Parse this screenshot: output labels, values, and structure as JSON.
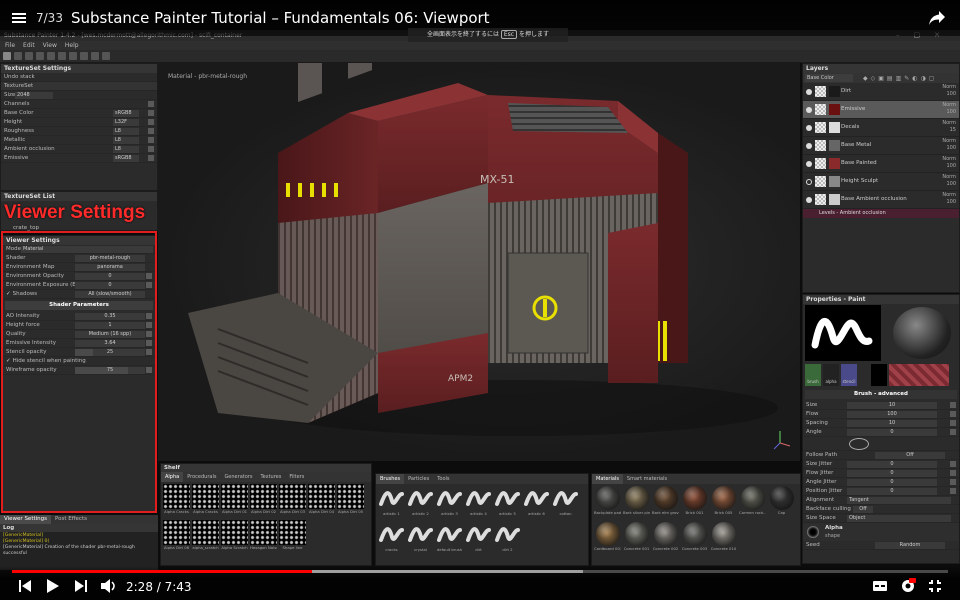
{
  "youtube": {
    "counter": "7/33",
    "title": "Substance Painter Tutorial – Fundamentals 06: Viewport",
    "time": "2:28 / 7:43",
    "progress_fraction": 0.32,
    "buffered_fraction": 0.61,
    "fullscreen_msg": "全画面表示を終了するには",
    "fullscreen_key": "Esc",
    "fullscreen_msg_tail": "を押します",
    "accent": "#ff0000"
  },
  "app": {
    "window_title": "Substance Painter 1.4.2 - [wes.mcdermott@allegorithmic.com] - scifi_container",
    "menu": [
      "File",
      "Edit",
      "View",
      "Help"
    ]
  },
  "textureset_settings": {
    "title": "TextureSet Settings",
    "undo": "Undo stack",
    "textureset_label": "TextureSet",
    "size_label": "Size",
    "size_value": "2048",
    "channels_label": "Channels",
    "channels": [
      {
        "name": "Base Color",
        "fmt": "sRGB8"
      },
      {
        "name": "Height",
        "fmt": "L32F"
      },
      {
        "name": "Roughness",
        "fmt": "L8"
      },
      {
        "name": "Metallic",
        "fmt": "L8"
      },
      {
        "name": "Ambient occlusion",
        "fmt": "L8"
      },
      {
        "name": "Emissive",
        "fmt": "sRGB8"
      }
    ]
  },
  "textureset_list": {
    "title": "TextureSet List",
    "item": "crate_top"
  },
  "callout": "Viewer Settings",
  "viewer_settings": {
    "title": "Viewer Settings",
    "mode_label": "Mode",
    "mode_value": "Material",
    "rows": [
      {
        "label": "Shader",
        "value": "pbr-metal-rough"
      },
      {
        "label": "Environment Map",
        "value": "panorama"
      },
      {
        "label": "Environment Opacity",
        "value": "0"
      },
      {
        "label": "Environment Exposure (EV)",
        "value": "0"
      },
      {
        "label": "Shadows",
        "value": "All (slow/smooth)"
      }
    ],
    "shader_params_title": "Shader Parameters",
    "shader_params": [
      {
        "label": "AO Intensity",
        "value": "0.35"
      },
      {
        "label": "Height force",
        "value": "1"
      },
      {
        "label": "Quality",
        "value": "Medium (16 spp)"
      },
      {
        "label": "Emissive Intensity",
        "value": "3.64"
      }
    ],
    "stencil_label": "Stencil opacity",
    "stencil_value": "25",
    "hide_stencil": "Hide stencil when painting",
    "wire_label": "Wireframe opacity",
    "wire_value": "75"
  },
  "left_tabs": [
    "Viewer Settings",
    "Post Effects"
  ],
  "log": {
    "title": "Log",
    "lines": [
      "[GenericMaterial]",
      "[GenericMaterial] 0(",
      "[GenericMaterial] Creation of the shader pbr-metal-rough",
      "successful"
    ]
  },
  "viewport": {
    "label": "Material - pbr-metal-rough",
    "decal_1": "MX-51",
    "decal_2": "APM2"
  },
  "layers": {
    "title": "Layers",
    "channel": "Base Color",
    "items": [
      {
        "name": "Dirt",
        "blend": "Norm",
        "opacity": "100"
      },
      {
        "name": "Emissive",
        "blend": "Norm",
        "opacity": "100"
      },
      {
        "name": "Decals",
        "blend": "Norm",
        "opacity": "15"
      },
      {
        "name": "Base Metal",
        "blend": "Norm",
        "opacity": "100"
      },
      {
        "name": "Base Painted",
        "blend": "Norm",
        "opacity": "100"
      },
      {
        "name": "Height Sculpt",
        "blend": "Norm",
        "opacity": "100"
      },
      {
        "name": "Base Ambient occlusion",
        "blend": "Norm",
        "opacity": "100"
      }
    ],
    "levels": "Levels - Ambient occlusion"
  },
  "properties": {
    "title": "Properties - Paint",
    "slots": [
      "brush",
      "alpha",
      "stencil"
    ],
    "brush_advanced": "Brush - advanced",
    "rows": [
      {
        "label": "Size",
        "value": "10"
      },
      {
        "label": "Flow",
        "value": "100"
      },
      {
        "label": "Spacing",
        "value": "10"
      },
      {
        "label": "Angle",
        "value": "0"
      }
    ],
    "follow_path": "Follow Path",
    "follow_value": "Off",
    "jitters": [
      {
        "label": "Size Jitter",
        "value": "0"
      },
      {
        "label": "Flow Jitter",
        "value": "0"
      },
      {
        "label": "Angle Jitter",
        "value": "0"
      },
      {
        "label": "Position Jitter",
        "value": "0"
      }
    ],
    "alignment_label": "Alignment",
    "alignment_value": "Tangent",
    "backface_label": "Backface culling",
    "backface_value": "Off",
    "size_space_label": "Size Space",
    "size_space_value": "Object",
    "alpha_label": "Alpha",
    "alpha_sub": "shape",
    "seed_label": "Seed",
    "seed_value": "Random"
  },
  "shelf": {
    "title": "Shelf",
    "tabs": [
      "Alpha",
      "Procedurals",
      "Generators",
      "Textures",
      "Filters"
    ],
    "search": "Search...",
    "alphas": [
      "Alpha Cracks",
      "Alpha Cracks",
      "Alpha Dirt 01",
      "Alpha Dirt 02",
      "Alpha Dirt 03",
      "Alpha Dirt 04",
      "Alpha Dirt 05",
      "Alpha Dirt 06",
      "alpha_scratch",
      "Alpha Scratch",
      "Hexagon Noise",
      "Shape line"
    ]
  },
  "brushes": {
    "tabs": [
      "Brushes",
      "Particles",
      "Tools"
    ],
    "search": "Search...",
    "items": [
      "artistic 1",
      "artistic 2",
      "artistic 3",
      "artistic 4",
      "artistic 5",
      "artistic 6",
      "cotton",
      "cracks",
      "crystal",
      "default brush",
      "dirt",
      "dirt 2"
    ]
  },
  "materials": {
    "tabs": [
      "Materials",
      "Smart materials"
    ],
    "search": "Search...",
    "items": [
      {
        "name": "Backplate pad...",
        "color": "#5a5a58"
      },
      {
        "name": "Bark silver pine",
        "color": "#8a7a5a"
      },
      {
        "name": "Bark elm grove",
        "color": "#6a4a30"
      },
      {
        "name": "Brick 001",
        "color": "#8a4a32"
      },
      {
        "name": "Brick 005",
        "color": "#9a6040"
      },
      {
        "name": "Carmen rock...",
        "color": "#6a6a60"
      },
      {
        "name": "Cap",
        "color": "#3a3a3a"
      },
      {
        "name": "Cardboard 001",
        "color": "#a07a48"
      },
      {
        "name": "Concrete 001",
        "color": "#7a7a72"
      },
      {
        "name": "Concrete 002",
        "color": "#8a8680"
      },
      {
        "name": "Concrete 003",
        "color": "#6e6e6a"
      },
      {
        "name": "Concrete 010",
        "color": "#9a968e"
      }
    ]
  }
}
